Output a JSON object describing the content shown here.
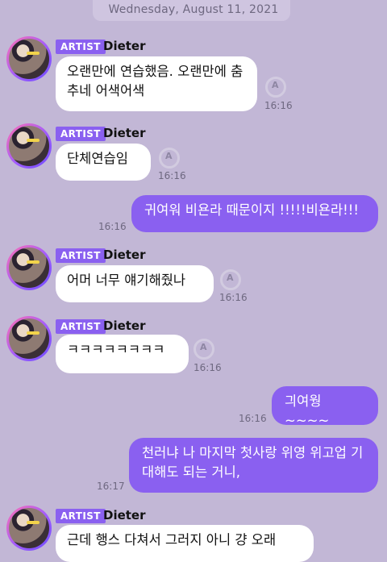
{
  "date_label": "Wednesday, August 11, 2021",
  "artist_badge": "ARTIST",
  "sender_name": "Dieter",
  "messages": [
    {
      "dir": "in",
      "text": "오랜만에 연습했음. 오랜만에 춤추네 어색어색",
      "time": "16:16"
    },
    {
      "dir": "in",
      "text": "단체연습임",
      "time": "16:16"
    },
    {
      "dir": "out",
      "text": "귀여워 비욘라 때문이지 !!!!!비욘라!!!",
      "time": "16:16"
    },
    {
      "dir": "in",
      "text": "어머 너무 얘기해줬나",
      "time": "16:16"
    },
    {
      "dir": "in",
      "text": "ㅋㅋㅋㅋㅋㅋㅋㅋ",
      "time": "16:16"
    },
    {
      "dir": "out",
      "text": "긔여웡 ~~~~",
      "time": "16:16"
    },
    {
      "dir": "out",
      "text": "천러냐 나 마지막 첫사랑 위영 위고업 기대해도 되는 거니,",
      "time": "16:17"
    },
    {
      "dir": "in",
      "text": "근데 행스 다쳐서 그러지 아니 걍 오래",
      "time": ""
    }
  ],
  "icons": {
    "avatar": "artist-avatar",
    "translate": "translate-icon"
  },
  "colors": {
    "background": "#c2b7d6",
    "bubble_in": "#ffffff",
    "bubble_out": "#8a60f0",
    "badge": "#8a60f0"
  }
}
